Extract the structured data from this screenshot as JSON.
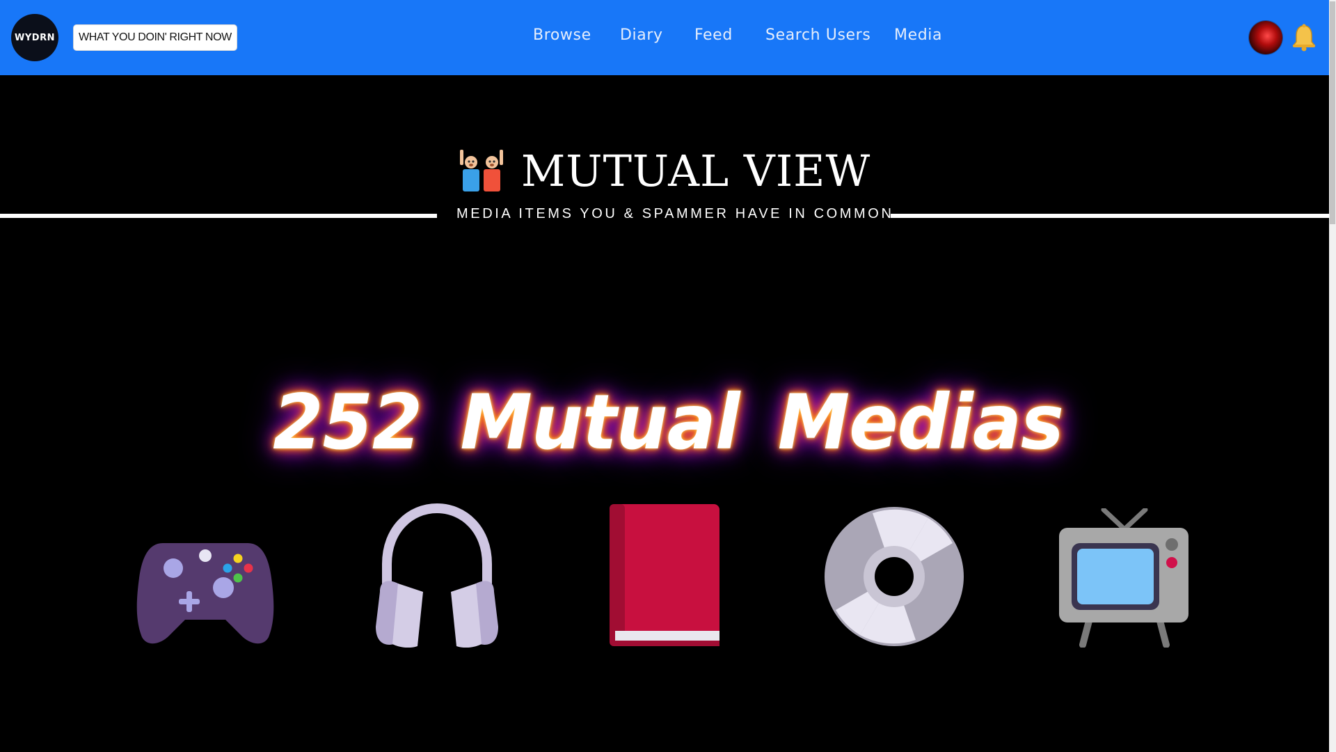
{
  "header": {
    "logo_text": "WYDRN",
    "status_button": "WHAT YOU DOIN' RIGHT NOW",
    "nav": [
      "Browse",
      "Diary",
      "Feed",
      "Search Users",
      "Media"
    ],
    "brand_color": "#1877f8"
  },
  "main": {
    "title": "MUTUAL VIEW",
    "subtitle": "MEDIA ITEMS YOU & SPAMMER HAVE IN COMMON",
    "count_text": "252 Mutual Medias",
    "media_icons": [
      "game-controller-icon",
      "headphones-icon",
      "book-icon",
      "disc-icon",
      "tv-icon"
    ]
  }
}
